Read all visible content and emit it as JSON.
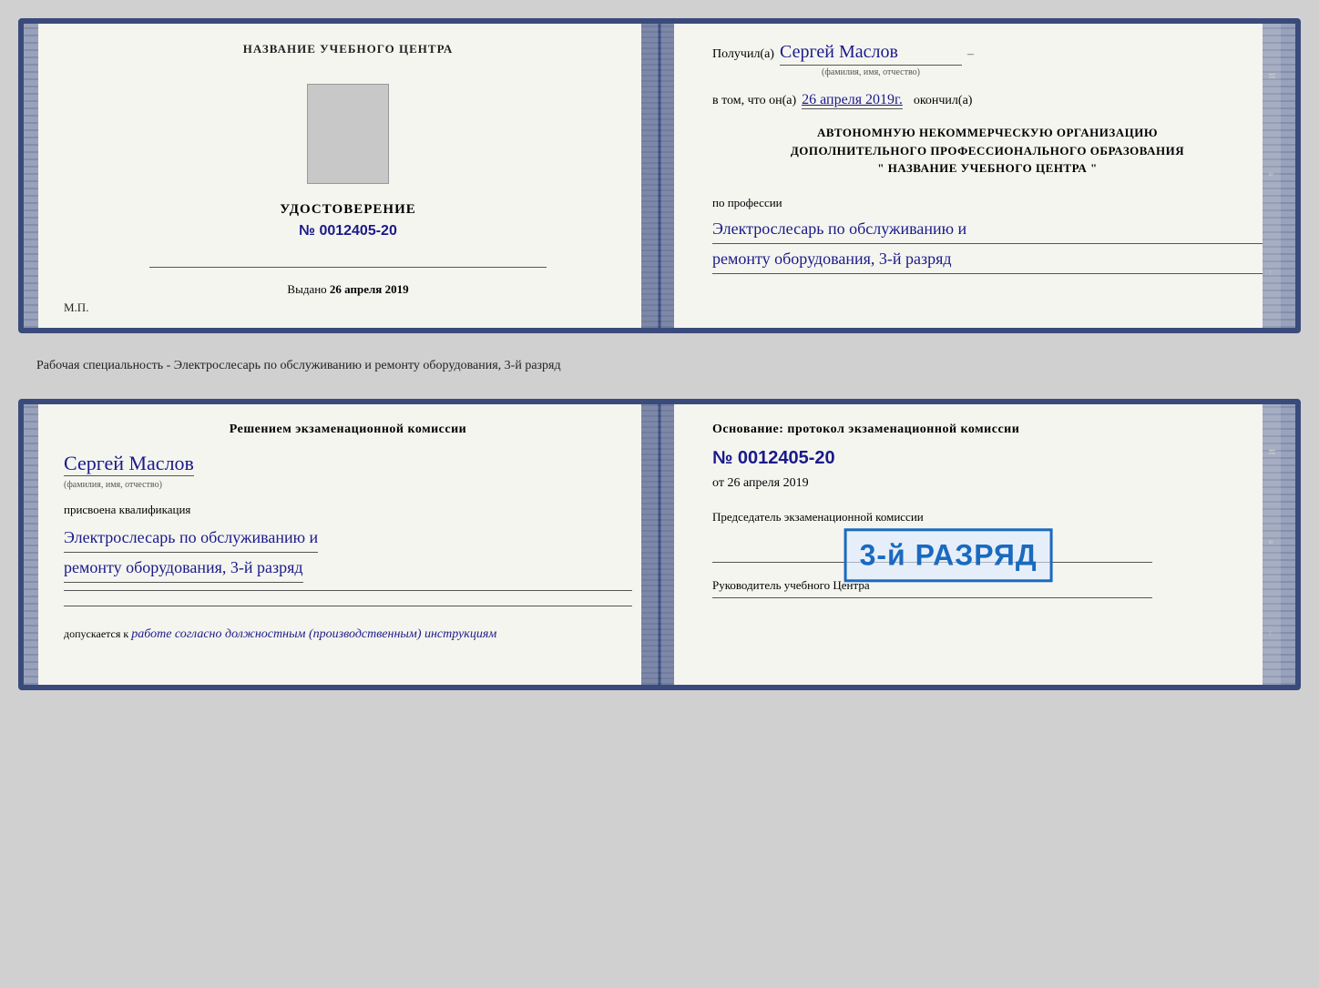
{
  "top_booklet": {
    "left": {
      "title": "НАЗВАНИЕ УЧЕБНОГО ЦЕНТРА",
      "doc_type": "УДОСТОВЕРЕНИЕ",
      "doc_number_label": "№",
      "doc_number": "0012405-20",
      "issued_label": "Выдано",
      "issued_date": "26 апреля 2019",
      "mp_label": "М.П."
    },
    "right": {
      "received_label": "Получил(а)",
      "recipient_name": "Сергей Маслов",
      "name_sublabel": "(фамилия, имя, отчество)",
      "dash": "–",
      "vtom_label": "в том, что он(а)",
      "vtom_date": "26 апреля 2019г.",
      "okoncil_label": "окончил(а)",
      "org_line1": "АВТОНОМНУЮ НЕКОММЕРЧЕСКУЮ ОРГАНИЗАЦИЮ",
      "org_line2": "ДОПОЛНИТЕЛЬНОГО ПРОФЕССИОНАЛЬНОГО ОБРАЗОВАНИЯ",
      "org_name": "\" НАЗВАНИЕ УЧЕБНОГО ЦЕНТРА \"",
      "profession_label": "по профессии",
      "profession_line1": "Электрослесарь по обслуживанию и",
      "profession_line2": "ремонту оборудования, 3-й разряд"
    }
  },
  "middle": {
    "text": "Рабочая специальность - Электрослесарь по обслуживанию и ремонту оборудования, 3-й разряд"
  },
  "bottom_booklet": {
    "left": {
      "decision_title": "Решением экзаменационной комиссии",
      "person_name": "Сергей Маслов",
      "name_sublabel": "(фамилия, имя, отчество)",
      "assigned_label": "присвоена квалификация",
      "qual_line1": "Электрослесарь по обслуживанию и",
      "qual_line2": "ремонту оборудования, 3-й разряд",
      "dopuskaetsya_label": "допускается к",
      "dopuskaetsya_text": "работе согласно должностным (производственным) инструкциям"
    },
    "right": {
      "osnov_title": "Основание: протокол экзаменационной комиссии",
      "protocol_number_label": "№",
      "protocol_number": "0012405-20",
      "date_label": "от",
      "date_value": "26 апреля 2019",
      "chairman_label": "Председатель экзаменационной комиссии",
      "rukov_label": "Руководитель учебного Центра",
      "stamp_text": "3-й РАЗРЯД"
    }
  }
}
